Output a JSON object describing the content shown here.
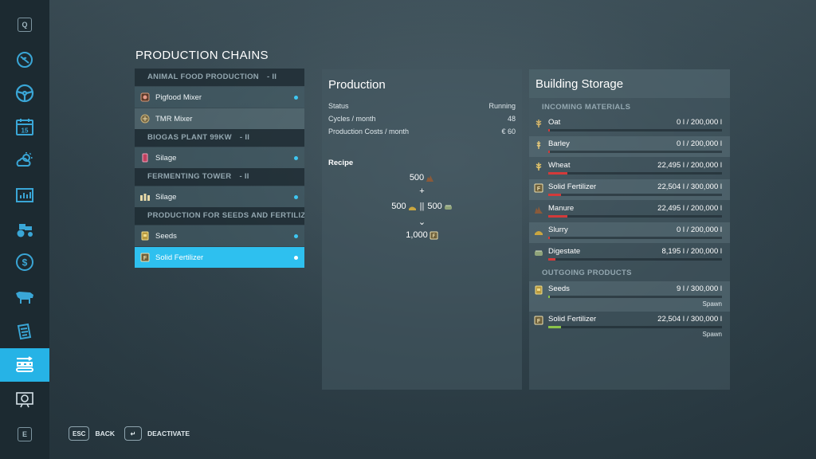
{
  "sidebar": {
    "top_key": "Q",
    "bottom_key": "E",
    "icons": [
      "radio-icon",
      "steering-wheel-icon",
      "calendar-icon",
      "weather-icon",
      "stats-icon",
      "tractor-icon",
      "money-icon",
      "cow-icon",
      "contracts-icon",
      "production-icon",
      "help-icon"
    ],
    "calendar_day": "15",
    "active": "production-icon"
  },
  "title": "PRODUCTION CHAINS",
  "chains": [
    {
      "group": "ANIMAL FOOD PRODUCTION",
      "paused": "II",
      "items": [
        {
          "label": "Pigfood Mixer",
          "icon": "pigfood-icon",
          "active": true
        },
        {
          "label": "TMR Mixer",
          "icon": "tmr-icon",
          "active": false
        }
      ]
    },
    {
      "group": "BIOGAS PLANT 99KW",
      "paused": "II",
      "items": [
        {
          "label": "Silage",
          "icon": "silage-icon",
          "active": true
        }
      ]
    },
    {
      "group": "FERMENTING TOWER",
      "paused": "II",
      "items": [
        {
          "label": "Silage",
          "icon": "silage-bales-icon",
          "active": true
        }
      ]
    },
    {
      "group": "PRODUCTION FOR SEEDS AND FERTILIZ...",
      "paused": "",
      "items": [
        {
          "label": "Seeds",
          "icon": "seeds-icon",
          "active": true
        },
        {
          "label": "Solid Fertilizer",
          "icon": "fertilizer-icon",
          "active": true,
          "selected": true
        }
      ]
    }
  ],
  "production": {
    "heading": "Production",
    "status_label": "Status",
    "status_value": "Running",
    "cycles_label": "Cycles / month",
    "cycles_value": "48",
    "costs_label": "Production Costs / month",
    "costs_value": "€ 60",
    "recipe_heading": "Recipe",
    "recipe": {
      "input1": "500",
      "plus": "+",
      "input2a": "500",
      "or": "||",
      "input2b": "500",
      "arrow": "⌄",
      "output": "1,000"
    }
  },
  "storage": {
    "heading": "Building Storage",
    "incoming_heading": "INCOMING MATERIALS",
    "incoming": [
      {
        "name": "Oat",
        "amount": "0 l / 200,000 l",
        "fill": 0.0,
        "color": "#d33a3a"
      },
      {
        "name": "Barley",
        "amount": "0 l / 200,000 l",
        "fill": 0.0,
        "color": "#d33a3a"
      },
      {
        "name": "Wheat",
        "amount": "22,495 l / 200,000 l",
        "fill": 0.112,
        "color": "#d33a3a"
      },
      {
        "name": "Solid Fertilizer",
        "amount": "22,504 l / 300,000 l",
        "fill": 0.075,
        "color": "#d33a3a"
      },
      {
        "name": "Manure",
        "amount": "22,495 l / 200,000 l",
        "fill": 0.112,
        "color": "#d33a3a"
      },
      {
        "name": "Slurry",
        "amount": "0 l / 200,000 l",
        "fill": 0.0,
        "color": "#d33a3a"
      },
      {
        "name": "Digestate",
        "amount": "8,195 l / 200,000 l",
        "fill": 0.041,
        "color": "#d33a3a"
      }
    ],
    "outgoing_heading": "OUTGOING PRODUCTS",
    "outgoing": [
      {
        "name": "Seeds",
        "amount": "9 l / 300,000 l",
        "fill": 0.0,
        "color": "#8bc34a",
        "mode": "Spawn"
      },
      {
        "name": "Solid Fertilizer",
        "amount": "22,504 l / 300,000 l",
        "fill": 0.075,
        "color": "#8bc34a",
        "mode": "Spawn"
      }
    ]
  },
  "footer": {
    "back_key": "ESC",
    "back_label": "BACK",
    "deactivate_key": "↵",
    "deactivate_label": "DEACTIVATE"
  },
  "colors": {
    "accent": "#2ec0ef",
    "low_fill": "#d33a3a",
    "output_fill": "#8bc34a"
  }
}
